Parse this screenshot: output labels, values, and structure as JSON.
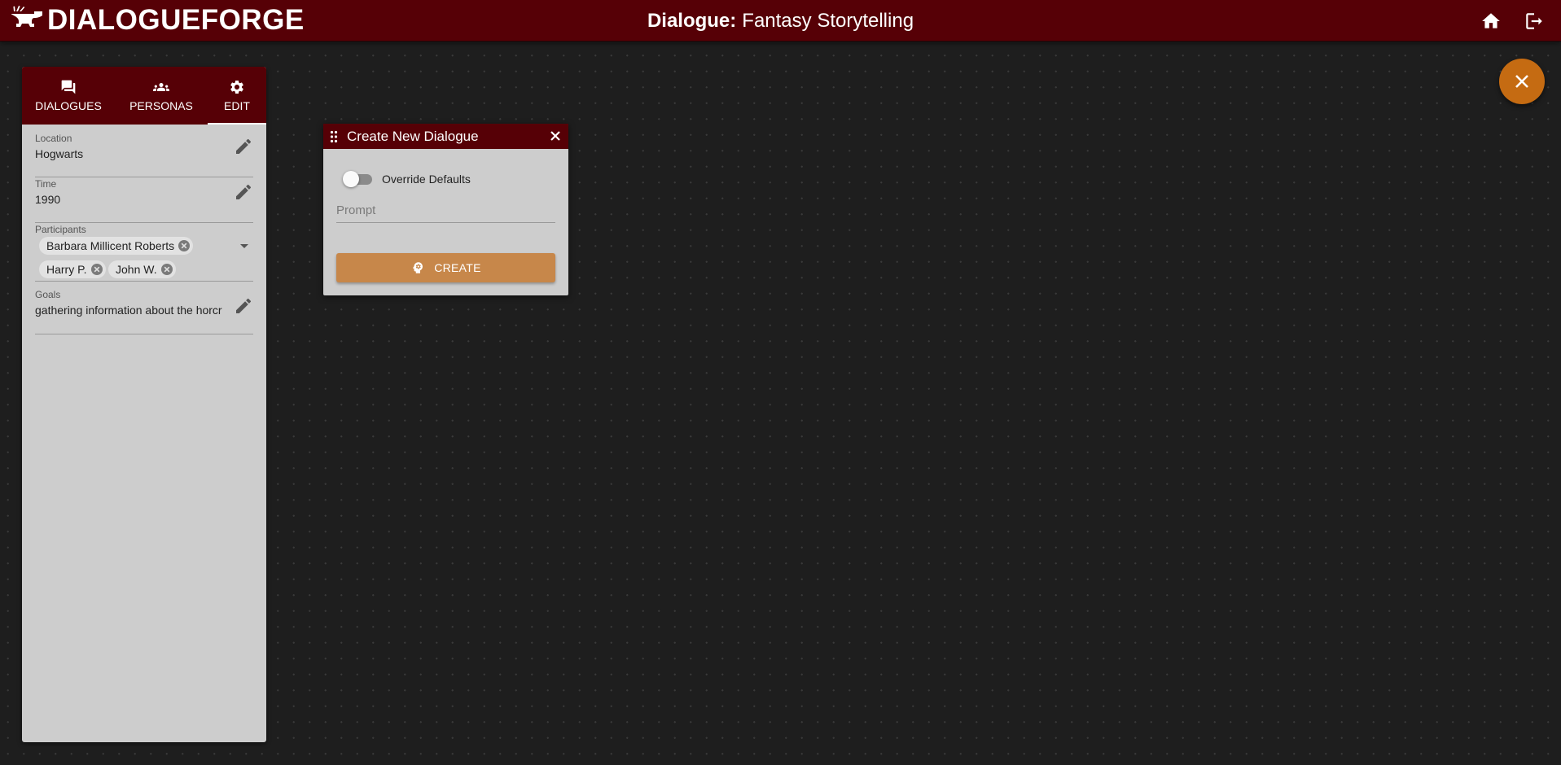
{
  "app": {
    "brand": "DIALOGUEFORGE",
    "title_prefix": "Dialogue:",
    "title": "Fantasy Storytelling",
    "icons": [
      "anvil-logo-icon",
      "home-icon",
      "logout-icon",
      "close-icon"
    ],
    "colors": {
      "header": "#560006",
      "accent": "#c56b12",
      "button": "#c7874a",
      "background": "#1e1e1e",
      "panel": "#cdcdcd"
    }
  },
  "tabs": [
    {
      "label": "DIALOGUES",
      "icon": "chat-icon"
    },
    {
      "label": "PERSONAS",
      "icon": "people-icon"
    },
    {
      "label": "EDIT",
      "icon": "gear-icon",
      "active": true
    }
  ],
  "edit": {
    "location": {
      "label": "Location",
      "value": "Hogwarts"
    },
    "time": {
      "label": "Time",
      "value": "1990"
    },
    "participants": {
      "label": "Participants",
      "chips": [
        "Barbara Millicent Roberts",
        "Harry P.",
        "John W."
      ]
    },
    "goals": {
      "label": "Goals",
      "value": "gathering information about the horcr"
    }
  },
  "dialog": {
    "title": "Create New Dialogue",
    "toggle_label": "Override Defaults",
    "toggle_on": false,
    "prompt_placeholder": "Prompt",
    "create_label": "CREATE"
  }
}
